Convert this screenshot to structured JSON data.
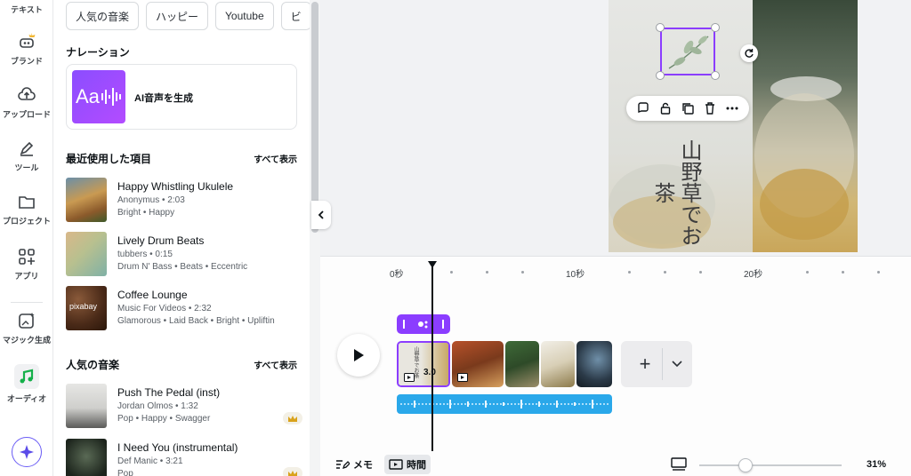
{
  "rail": {
    "items": [
      {
        "label": "テキスト"
      },
      {
        "label": "ブランド"
      },
      {
        "label": "アップロード"
      },
      {
        "label": "ツール"
      },
      {
        "label": "プロジェクト"
      },
      {
        "label": "アプリ"
      },
      {
        "label": "マジック生成"
      },
      {
        "label": "オーディオ"
      }
    ]
  },
  "panel": {
    "chips": [
      "人気の音楽",
      "ハッピー",
      "Youtube",
      "ビ"
    ],
    "narration": {
      "title": "ナレーション",
      "ai_label": "AI音声を生成",
      "ai_thumb_text": "Aa"
    },
    "recent": {
      "title": "最近使用した項目",
      "show_all": "すべて表示",
      "tracks": [
        {
          "title": "Happy Whistling Ukulele",
          "meta": "Anonymus • 2:03",
          "tags": "Bright • Happy"
        },
        {
          "title": "Lively Drum Beats",
          "meta": "tubbers • 0:15",
          "tags": "Drum N' Bass • Beats • Eccentric"
        },
        {
          "title": "Coffee Lounge",
          "meta": "Music For Videos • 2:32",
          "tags": "Glamorous • Laid Back • Bright • Upliftin",
          "thumb_text": "pixabay"
        }
      ]
    },
    "popular": {
      "title": "人気の音楽",
      "show_all": "すべて表示",
      "tracks": [
        {
          "title": "Push The Pedal (inst)",
          "meta": "Jordan Olmos • 1:32",
          "tags": "Pop • Happy • Swagger"
        },
        {
          "title": "I Need You (instrumental)",
          "meta": "Def Manic • 3:21",
          "tags": "Pop"
        }
      ]
    }
  },
  "canvas": {
    "vertical_text": "山野草でお茶"
  },
  "timeline": {
    "ruler": [
      "0秒",
      "10秒",
      "20秒"
    ],
    "first_clip_duration": "3.0",
    "first_clip_label": "山野草でお茶"
  },
  "footer": {
    "notes_label": "メモ",
    "time_label": "時間",
    "zoom": "31%"
  },
  "colors": {
    "accent": "#8b3dff",
    "audio": "#2aa8ea"
  }
}
